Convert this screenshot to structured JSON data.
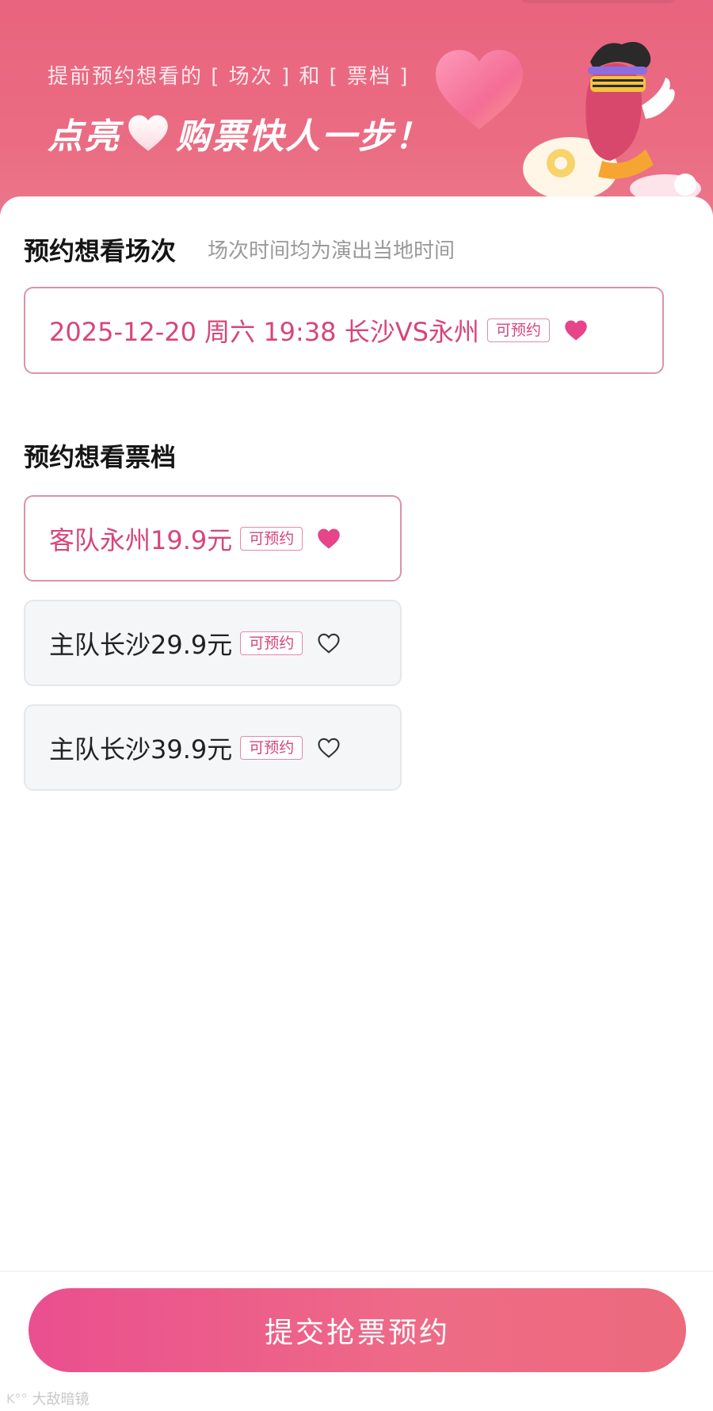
{
  "banner": {
    "subtitle": "提前预约想看的 [ 场次 ] 和 [ 票档 ]",
    "title_part1": "点亮",
    "title_part2": "购票快人一步！"
  },
  "session_section": {
    "title": "预约想看场次",
    "hint": "场次时间均为演出当地时间",
    "options": [
      {
        "label": "2025-12-20 周六 19:38 长沙VS永州",
        "badge": "可预约",
        "selected": true
      }
    ]
  },
  "ticket_section": {
    "title": "预约想看票档",
    "options": [
      {
        "label": "客队永州19.9元",
        "badge": "可预约",
        "selected": true
      },
      {
        "label": "主队长沙29.9元",
        "badge": "可预约",
        "selected": false
      },
      {
        "label": "主队长沙39.9元",
        "badge": "可预约",
        "selected": false
      }
    ]
  },
  "submit_label": "提交抢票预约",
  "watermark": {
    "logo": "K°°",
    "text": "大敌暗镜"
  },
  "colors": {
    "accent": "#d6467b",
    "banner_bg": "#e9647e",
    "selected_border": "#dc93a5",
    "unselected_bg": "#f5f6f8"
  },
  "icons": {
    "heart_filled": "heart-filled-icon",
    "heart_outline": "heart-outline-icon"
  }
}
